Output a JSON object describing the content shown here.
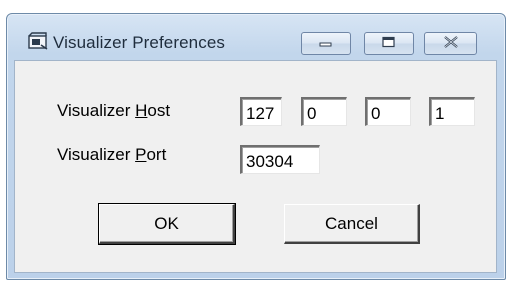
{
  "window": {
    "title": "Visualizer Preferences"
  },
  "caption_buttons": {
    "minimize_icon": "minimize-icon",
    "maximize_icon": "maximize-icon",
    "close_icon": "close-icon"
  },
  "host": {
    "label_prefix": "Visualizer ",
    "label_mnemonic": "H",
    "label_suffix": "ost",
    "octet1": "127",
    "octet2": "0",
    "octet3": "0",
    "octet4": "1"
  },
  "port": {
    "label_prefix": "Visualizer ",
    "label_mnemonic": "P",
    "label_suffix": "ort",
    "value": "30304"
  },
  "buttons": {
    "ok_label": "OK",
    "cancel_label": "Cancel"
  }
}
